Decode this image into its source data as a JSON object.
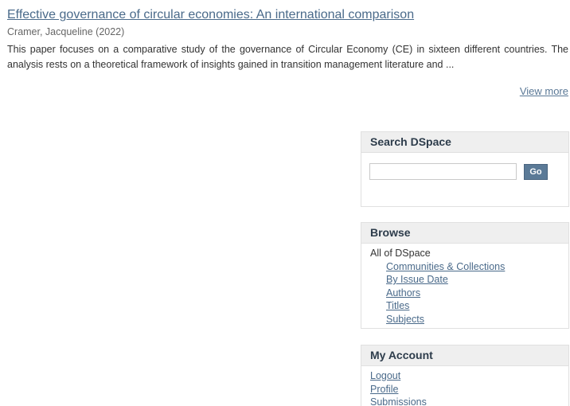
{
  "result": {
    "title": "Effective governance of circular economies: An international comparison",
    "author_date": "Cramer, Jacqueline (2022)",
    "abstract": "This paper focuses on a comparative study of the governance of Circular Economy (CE) in sixteen different countries. The analysis rests on a theoretical framework of insights gained in transition management literature and ...",
    "view_more_label": "View more"
  },
  "search": {
    "heading": "Search DSpace",
    "input_value": "",
    "go_label": "Go"
  },
  "browse": {
    "heading": "Browse",
    "root_label": "All of DSpace",
    "items": [
      {
        "label": "Communities & Collections"
      },
      {
        "label": "By Issue Date"
      },
      {
        "label": "Authors"
      },
      {
        "label": "Titles"
      },
      {
        "label": "Subjects"
      }
    ]
  },
  "account": {
    "heading": "My Account",
    "items": [
      {
        "label": "Logout"
      },
      {
        "label": "Profile"
      },
      {
        "label": "Submissions"
      }
    ]
  },
  "colors": {
    "link": "#4a6a8a",
    "panel_heading_bg": "#efefef",
    "button_bg": "#5b7a97"
  }
}
